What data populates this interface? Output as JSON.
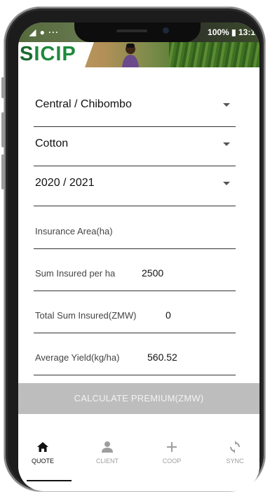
{
  "status_bar": {
    "left_icons": "◢ ● ···",
    "right_text": "100% ▮ 13:1"
  },
  "banner": {
    "logo_text": "ICIP",
    "logo_mark": "S"
  },
  "form": {
    "region": {
      "value": "Central / Chibombo"
    },
    "crop": {
      "value": "Cotton"
    },
    "season": {
      "value": "2020 / 2021"
    },
    "insurance_area": {
      "label": "Insurance Area(ha)",
      "value": ""
    },
    "sum_insured_per_ha": {
      "label": "Sum Insured per ha",
      "value": "2500"
    },
    "total_sum_insured": {
      "label": "Total Sum Insured(ZMW)",
      "value": "0"
    },
    "average_yield": {
      "label": "Average Yield(kg/ha)",
      "value": "560.52"
    }
  },
  "calculate_button": {
    "label": "CALCULATE PREMIUM(ZMW)"
  },
  "nav": {
    "items": [
      {
        "label": "QUOTE",
        "icon": "home-icon",
        "active": true
      },
      {
        "label": "CLIENT",
        "icon": "person-icon",
        "active": false
      },
      {
        "label": "COOP",
        "icon": "plus-icon",
        "active": false
      },
      {
        "label": "SYNC",
        "icon": "sync-icon",
        "active": false
      }
    ]
  },
  "colors": {
    "logo_green": "#1c8a3c",
    "button_disabled": "#bdbdbd",
    "nav_inactive": "#9e9e9e"
  }
}
